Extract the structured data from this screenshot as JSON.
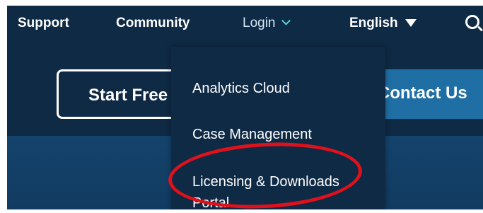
{
  "nav": {
    "support": "Support",
    "community": "Community",
    "login": "Login",
    "language": "English",
    "search_icon": "search-icon"
  },
  "hero": {
    "start_button": "Start Free",
    "contact_button": "Contact Us"
  },
  "dropdown": {
    "items": [
      "Analytics Cloud",
      "Case Management",
      "Licensing & Downloads Portal"
    ]
  },
  "colors": {
    "nav_bg": "#0f2a45",
    "accent_chevron": "#5ad2d8",
    "contact_button_bg": "#1f6fa5",
    "annotation_ring": "#e0111b"
  }
}
